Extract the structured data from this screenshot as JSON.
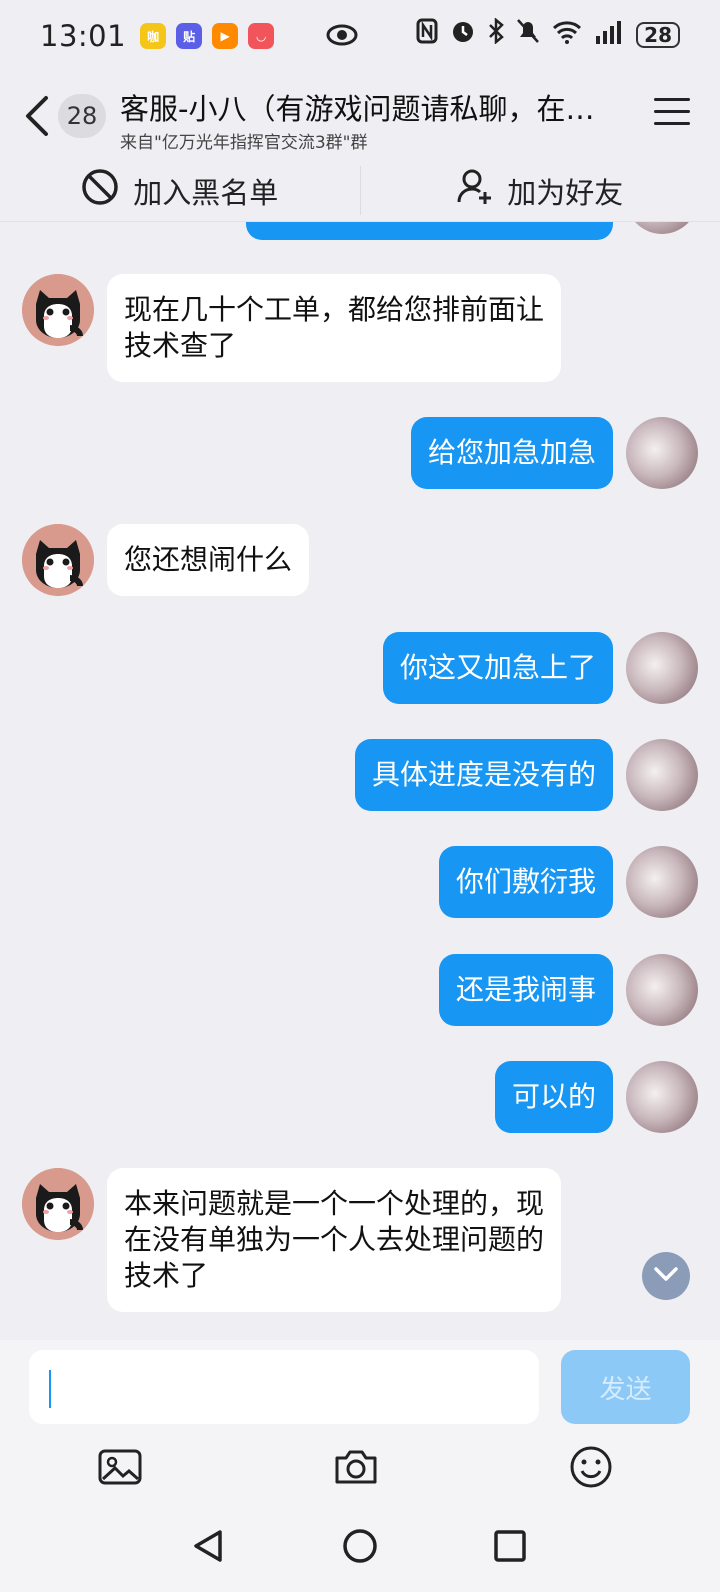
{
  "status_bar": {
    "time": "13:01",
    "apps": [
      {
        "name": "app-icon-yellow",
        "color": "#f5c518",
        "glyph": "咖"
      },
      {
        "name": "app-icon-purple",
        "color": "#5b5fe8",
        "glyph": "贴"
      },
      {
        "name": "app-icon-orange",
        "color": "#ff8a00",
        "glyph": "▶"
      },
      {
        "name": "app-icon-red",
        "color": "#f2545b",
        "glyph": "◡"
      }
    ],
    "battery": "28"
  },
  "header": {
    "unread_count": "28",
    "title": "客服-小八（有游戏问题请私聊，在…",
    "subtitle": "来自\"亿万光年指挥官交流3群\"群"
  },
  "actions": {
    "block_label": "加入黑名单",
    "add_friend_label": "加为好友"
  },
  "messages": [
    {
      "side": "in",
      "text": "现在几十个工单，都给您排前面让\n技术查了"
    },
    {
      "side": "out",
      "text": "给您加急加急"
    },
    {
      "side": "in",
      "text": "您还想闹什么"
    },
    {
      "side": "out",
      "text": "你这又加急上了"
    },
    {
      "side": "out",
      "text": "具体进度是没有的"
    },
    {
      "side": "out",
      "text": "你们敷衍我"
    },
    {
      "side": "out",
      "text": "还是我闹事"
    },
    {
      "side": "out",
      "text": "可以的"
    },
    {
      "side": "in",
      "text": "本来问题就是一个一个处理的，现\n在没有单独为一个人去处理问题的\n技术了"
    }
  ],
  "input": {
    "value": "",
    "send_label": "发送"
  },
  "colors": {
    "outgoing_bubble": "#1896f3",
    "incoming_bubble": "#ffffff",
    "background": "#efeff3"
  }
}
